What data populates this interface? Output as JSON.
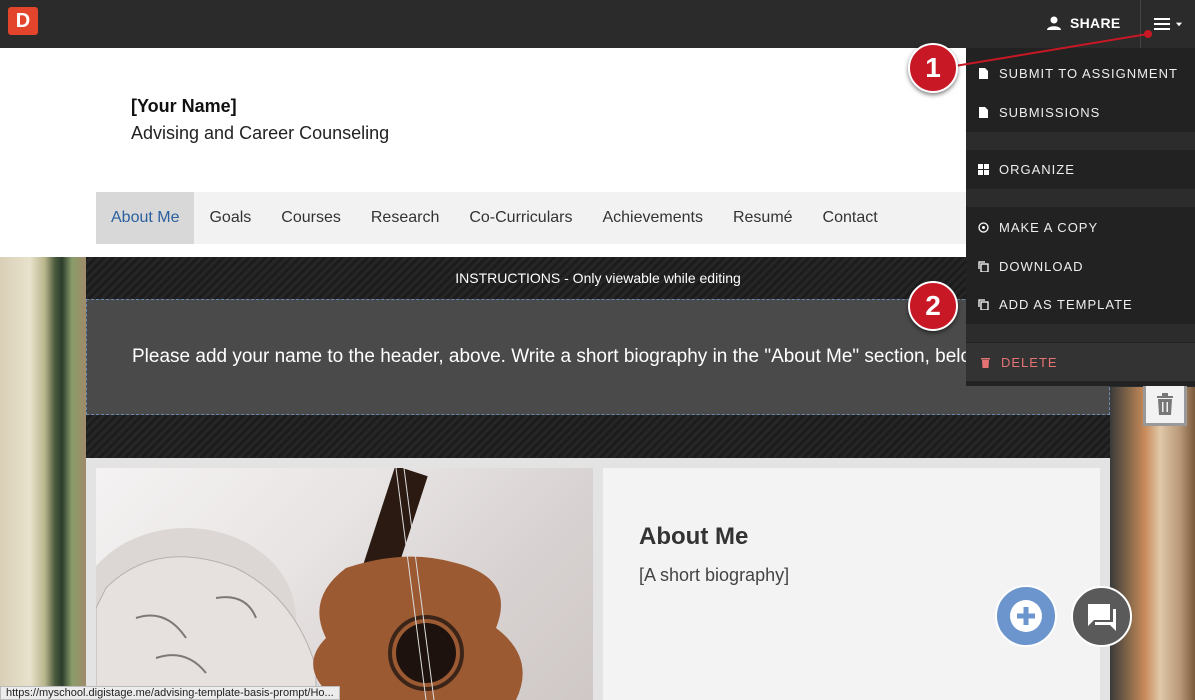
{
  "topbar": {
    "logo_letter": "D",
    "share_label": "SHARE"
  },
  "header": {
    "name": "[Your Name]",
    "subtitle": "Advising and Career Counseling"
  },
  "nav": {
    "items": [
      {
        "label": "About Me",
        "active": true
      },
      {
        "label": "Goals"
      },
      {
        "label": "Courses"
      },
      {
        "label": "Research"
      },
      {
        "label": "Co-Curriculars"
      },
      {
        "label": "Achievements"
      },
      {
        "label": "Resumé"
      },
      {
        "label": "Contact"
      }
    ]
  },
  "instructions": {
    "title": "INSTRUCTIONS - Only viewable while editing",
    "text": "Please add your name to the header, above. Write a short biography in the \"About Me\" section, belo"
  },
  "about": {
    "title": "About Me",
    "text": "[A short biography]"
  },
  "menu": {
    "submit": "SUBMIT TO ASSIGNMENT",
    "submissions": "SUBMISSIONS",
    "organize": "ORGANIZE",
    "copy": "MAKE A COPY",
    "download": "DOWNLOAD",
    "template": "ADD AS TEMPLATE",
    "delete": "DELETE"
  },
  "callouts": {
    "one": "1",
    "two": "2"
  },
  "statusbar": {
    "url": "https://myschool.digistage.me/advising-template-basis-prompt/Ho..."
  },
  "colors": {
    "accent": "#e2452c",
    "callout": "#c81825",
    "nav_active": "#2b5f9e",
    "fab_add": "#6b95cc"
  }
}
